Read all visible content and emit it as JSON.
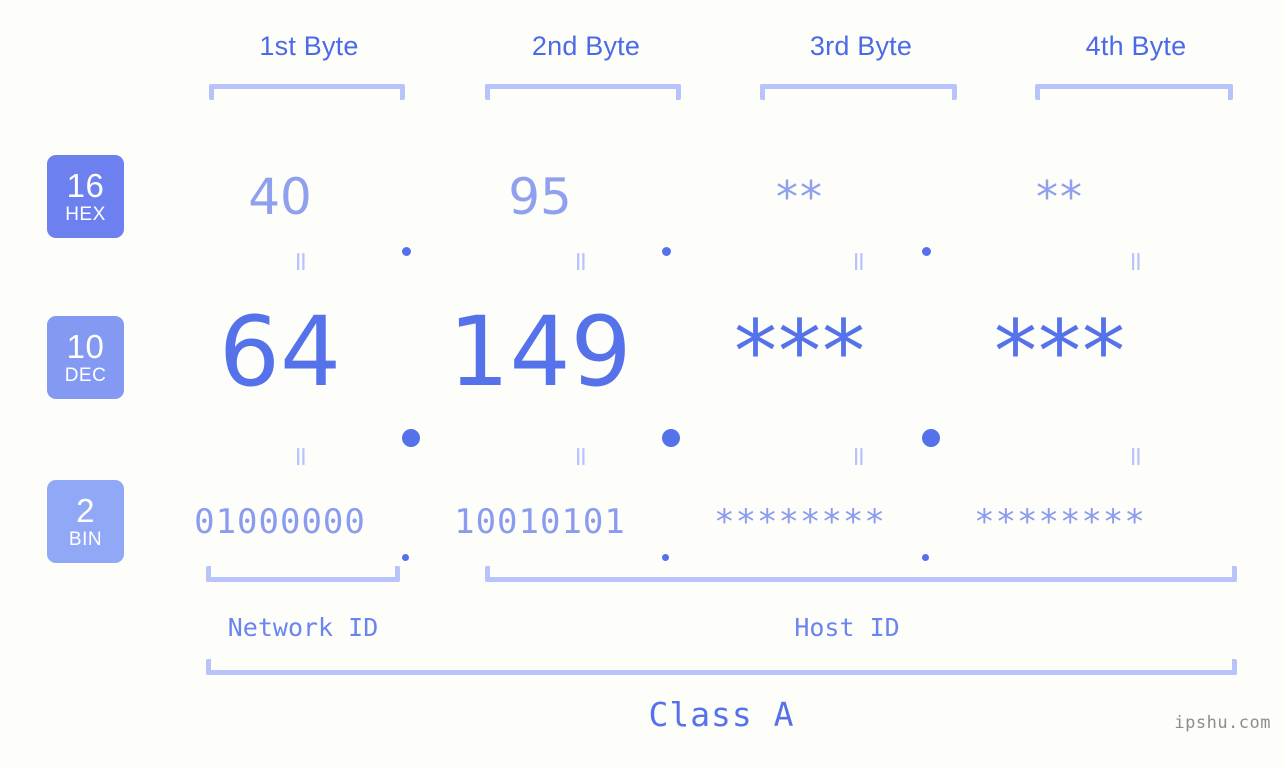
{
  "header": {
    "byte_labels": [
      "1st Byte",
      "2nd Byte",
      "3rd Byte",
      "4th Byte"
    ]
  },
  "bases": [
    {
      "number": "16",
      "unit": "HEX",
      "color": "#6d80ef"
    },
    {
      "number": "10",
      "unit": "DEC",
      "color": "#8499f2"
    },
    {
      "number": "2",
      "unit": "BIN",
      "color": "#90a8f5"
    }
  ],
  "rows": {
    "hex": {
      "values": [
        "40",
        "95",
        "**",
        "**"
      ]
    },
    "dec": {
      "values": [
        "64",
        "149",
        "***",
        "***"
      ]
    },
    "bin": {
      "values": [
        "01000000",
        "10010101",
        "********",
        "********"
      ]
    }
  },
  "separator": {
    "dot": ".",
    "equals": "="
  },
  "segments": {
    "network_id": "Network ID",
    "host_id": "Host ID",
    "class": "Class A"
  },
  "watermark": "ipshu.com",
  "colors": {
    "background": "#fdfdfa",
    "accent": "#5672ea",
    "header_text": "#4c6ae8",
    "bracket": "#b9c3fb",
    "hex_text": "#8fa0ee",
    "bin_text": "#8b9bee",
    "watermark_text": "#8d8d8d"
  }
}
